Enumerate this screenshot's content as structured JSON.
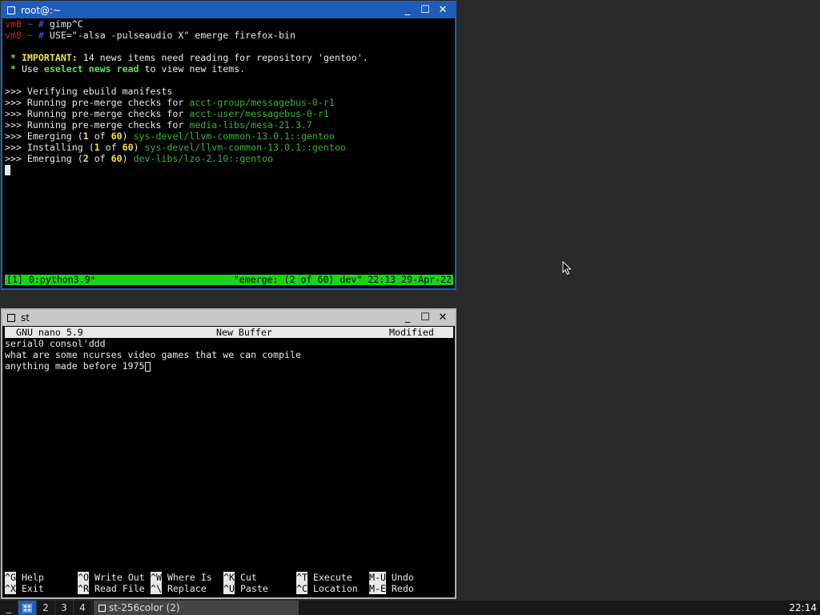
{
  "window1": {
    "title": "root@:~",
    "controls": {
      "minimize": "_",
      "maximize": "☐",
      "close": "✕"
    },
    "lines": [
      [
        {
          "t": "vm8",
          "c": "red"
        },
        {
          "t": " ~ ",
          "c": "blue"
        },
        {
          "t": "# ",
          "c": "blue"
        },
        {
          "t": "gimp^C",
          "c": ""
        }
      ],
      [
        {
          "t": "vm8",
          "c": "red"
        },
        {
          "t": " ~ ",
          "c": "blue"
        },
        {
          "t": "# ",
          "c": "blue"
        },
        {
          "t": "USE=\"-alsa -pulseaudio X\" emerge firefox-bin",
          "c": ""
        }
      ],
      [
        {
          "t": "",
          "c": ""
        }
      ],
      [
        {
          "t": " * ",
          "c": "bgrn"
        },
        {
          "t": "IMPORTANT:",
          "c": "yel"
        },
        {
          "t": " 14 news items need reading for repository 'gentoo'.",
          "c": ""
        }
      ],
      [
        {
          "t": " * ",
          "c": "bgrn"
        },
        {
          "t": "Use ",
          "c": ""
        },
        {
          "t": "eselect news read",
          "c": "bgrn"
        },
        {
          "t": " to view new items.",
          "c": ""
        }
      ],
      [
        {
          "t": "",
          "c": ""
        }
      ],
      [
        {
          "t": ">>> Verifying ebuild manifests",
          "c": ""
        }
      ],
      [
        {
          "t": ">>> Running pre-merge checks for ",
          "c": ""
        },
        {
          "t": "acct-group/messagebus-0-r1",
          "c": "grn"
        }
      ],
      [
        {
          "t": ">>> Running pre-merge checks for ",
          "c": ""
        },
        {
          "t": "acct-user/messagebus-0-r1",
          "c": "grn"
        }
      ],
      [
        {
          "t": ">>> Running pre-merge checks for ",
          "c": ""
        },
        {
          "t": "media-libs/mesa-21.3.7",
          "c": "grn"
        }
      ],
      [
        {
          "t": ">>> Emerging (",
          "c": ""
        },
        {
          "t": "1",
          "c": "yel"
        },
        {
          "t": " of ",
          "c": ""
        },
        {
          "t": "60",
          "c": "yel"
        },
        {
          "t": ") ",
          "c": ""
        },
        {
          "t": "sys-devel/llvm-common-13.0.1::gentoo",
          "c": "grn"
        }
      ],
      [
        {
          "t": ">>> Installing (",
          "c": ""
        },
        {
          "t": "1",
          "c": "yel"
        },
        {
          "t": " of ",
          "c": ""
        },
        {
          "t": "60",
          "c": "yel"
        },
        {
          "t": ") ",
          "c": ""
        },
        {
          "t": "sys-devel/llvm-common-13.0.1::gentoo",
          "c": "grn"
        }
      ],
      [
        {
          "t": ">>> Emerging (",
          "c": ""
        },
        {
          "t": "2",
          "c": "yel"
        },
        {
          "t": " of ",
          "c": ""
        },
        {
          "t": "60",
          "c": "yel"
        },
        {
          "t": ") ",
          "c": ""
        },
        {
          "t": "dev-libs/lzo-2.10::gentoo",
          "c": "grn"
        }
      ]
    ],
    "status_left": "[1] 0:python3.9*",
    "status_right": "\"emerge: (2 of 60) dev\" 22:13 29-Apr-22"
  },
  "window2": {
    "title": "st",
    "controls": {
      "minimize": "_",
      "maximize": "☐",
      "close": "✕"
    },
    "nano": {
      "version": "GNU nano 5.9",
      "buffer": "New Buffer",
      "state": "Modified",
      "lines": [
        "serial0 consol'ddd",
        "what are some ncurses video games that we can compile",
        "anything made before 1975"
      ],
      "shortcuts_row1": [
        {
          "key": "^G",
          "label": "Help"
        },
        {
          "key": "^O",
          "label": "Write Out"
        },
        {
          "key": "^W",
          "label": "Where Is"
        },
        {
          "key": "^K",
          "label": "Cut"
        },
        {
          "key": "^T",
          "label": "Execute"
        },
        {
          "key": "M-U",
          "label": "Undo"
        }
      ],
      "shortcuts_row2": [
        {
          "key": "^X",
          "label": "Exit"
        },
        {
          "key": "^R",
          "label": "Read File"
        },
        {
          "key": "^\\",
          "label": "Replace"
        },
        {
          "key": "^U",
          "label": "Paste"
        },
        {
          "key": "^C",
          "label": "Location"
        },
        {
          "key": "M-E",
          "label": "Redo"
        }
      ]
    }
  },
  "taskbar": {
    "menu": "_",
    "workspaces": [
      "",
      "2",
      "3",
      "4"
    ],
    "task": "st-256color (2)",
    "clock": "22:14"
  },
  "colors": {
    "accent": "#1e5dba",
    "tmux_status": "#19d419"
  }
}
